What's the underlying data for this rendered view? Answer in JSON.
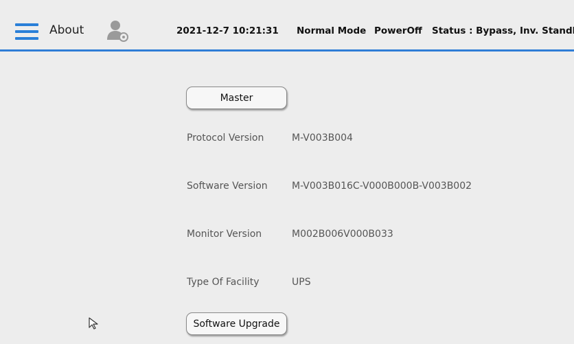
{
  "header": {
    "title": "About",
    "datetime": "2021-12-7 10:21:31",
    "mode": "Normal Mode",
    "power": "PowerOff",
    "status": "Status : Bypass, Inv. Standby",
    "accent_color": "#2f7dd6",
    "menu_icon": "hamburger-menu-icon",
    "user_icon": "user-settings-icon"
  },
  "main": {
    "master_button": "Master",
    "rows": [
      {
        "label": "Protocol Version",
        "value": "M-V003B004"
      },
      {
        "label": "Software Version",
        "value": "M-V003B016C-V000B000B-V003B002"
      },
      {
        "label": "Monitor Version",
        "value": "M002B006V000B033"
      },
      {
        "label": "Type Of Facility",
        "value": "UPS"
      }
    ],
    "upgrade_button": "Software Upgrade"
  }
}
